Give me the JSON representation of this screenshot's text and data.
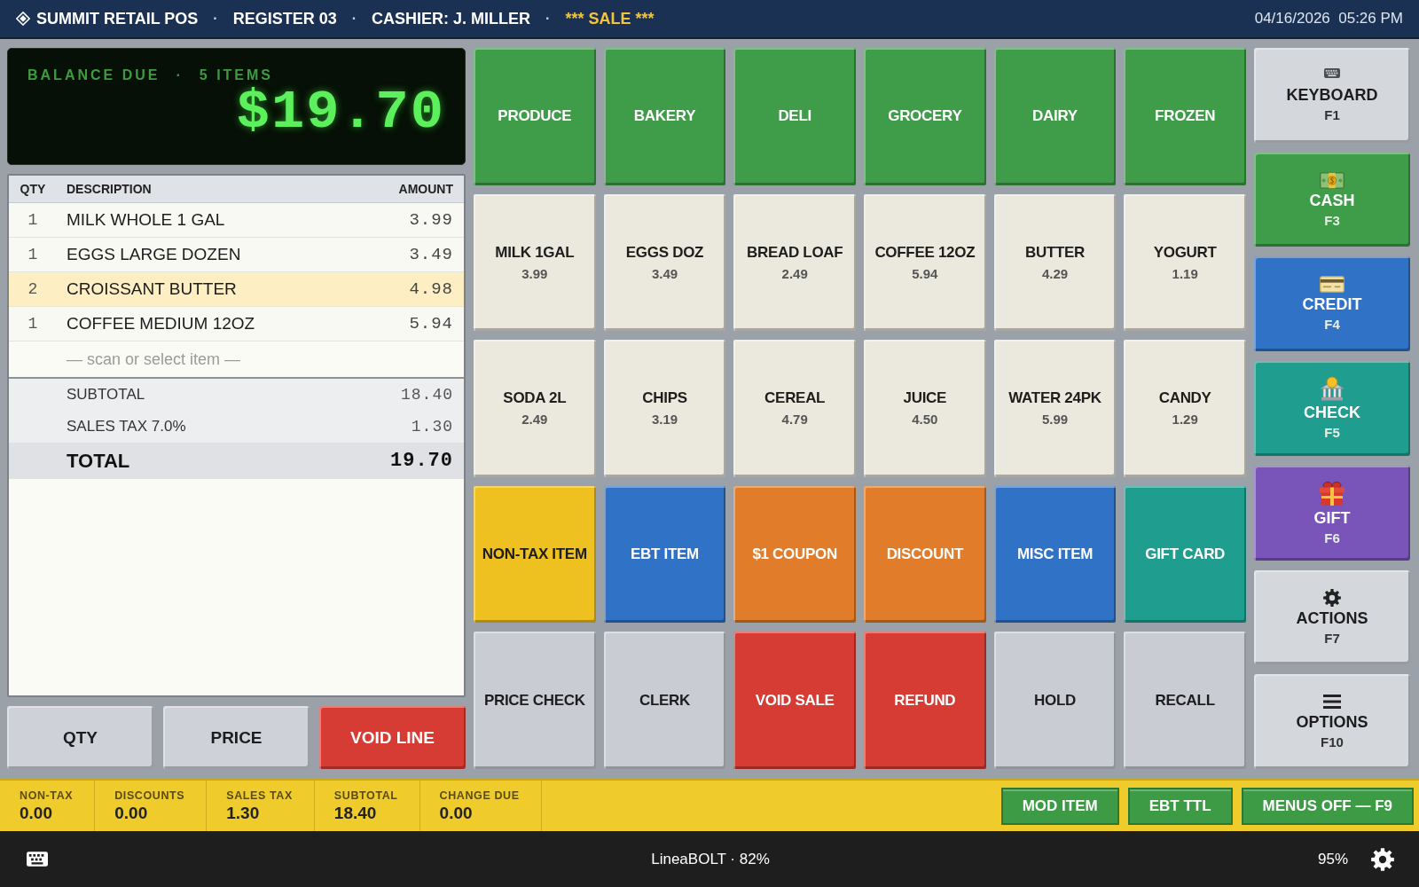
{
  "header": {
    "segments": [
      {
        "kind": "title",
        "text": "SUMMIT RETAIL POS"
      },
      {
        "kind": "sep",
        "text": "·"
      },
      {
        "kind": "info",
        "text": "REGISTER 03"
      },
      {
        "kind": "sep",
        "text": "·"
      },
      {
        "kind": "info",
        "text": "CASHIER: J. MILLER"
      },
      {
        "kind": "sep",
        "text": "·"
      },
      {
        "kind": "mode",
        "text": "*** SALE ***"
      }
    ],
    "datetime": "04/16/2026  05:26 PM"
  },
  "balance": {
    "label": "BALANCE DUE",
    "separator": "·",
    "item_count": "5 ITEMS",
    "amount": "$19.70"
  },
  "receipt": {
    "columns": [
      "QTY",
      "DESCRIPTION",
      "AMOUNT"
    ],
    "rows": [
      {
        "qty": "1",
        "description": "MILK WHOLE 1 GAL",
        "amount": "3.99",
        "selected": false
      },
      {
        "qty": "1",
        "description": "EGGS LARGE DOZEN",
        "amount": "3.49",
        "selected": false
      },
      {
        "qty": "2",
        "description": "CROISSANT BUTTER",
        "amount": "4.98",
        "selected": true
      },
      {
        "qty": "1",
        "description": "COFFEE MEDIUM 12OZ",
        "amount": "5.94",
        "selected": false
      }
    ],
    "prompt": "— scan or select item —",
    "totals": [
      {
        "kind": "line",
        "label": "SUBTOTAL",
        "value": "18.40"
      },
      {
        "kind": "line",
        "label": "SALES TAX 7.0%",
        "value": "1.30"
      },
      {
        "kind": "total",
        "label": "TOTAL",
        "value": "19.70"
      }
    ]
  },
  "line_buttons": [
    {
      "label": "QTY",
      "color": "#ced2d8"
    },
    {
      "label": "PRICE",
      "color": "#ced2d8"
    },
    {
      "label": "VOID LINE",
      "color": "#d63b34"
    }
  ],
  "keypad": [
    {
      "label": "PRODUCE",
      "color": "#3f9c48"
    },
    {
      "label": "BAKERY",
      "color": "#3f9c48"
    },
    {
      "label": "DELI",
      "color": "#3f9c48"
    },
    {
      "label": "GROCERY",
      "color": "#3f9c48"
    },
    {
      "label": "DAIRY",
      "color": "#3f9c48"
    },
    {
      "label": "FROZEN",
      "color": "#3f9c48"
    },
    {
      "label": "MILK 1GAL",
      "price": "3.99",
      "color": "#ebe8dd"
    },
    {
      "label": "EGGS DOZ",
      "price": "3.49",
      "color": "#ebe8dd"
    },
    {
      "label": "BREAD LOAF",
      "price": "2.49",
      "color": "#ebe8dd"
    },
    {
      "label": "COFFEE 12OZ",
      "price": "5.94",
      "color": "#ebe8dd"
    },
    {
      "label": "BUTTER",
      "price": "4.29",
      "color": "#ebe8dd"
    },
    {
      "label": "YOGURT",
      "price": "1.19",
      "color": "#ebe8dd"
    },
    {
      "label": "SODA 2L",
      "price": "2.49",
      "color": "#ebe8dd"
    },
    {
      "label": "CHIPS",
      "price": "3.19",
      "color": "#ebe8dd"
    },
    {
      "label": "CEREAL",
      "price": "4.79",
      "color": "#ebe8dd"
    },
    {
      "label": "JUICE",
      "price": "4.50",
      "color": "#ebe8dd"
    },
    {
      "label": "WATER 24PK",
      "price": "5.99",
      "color": "#ebe8dd"
    },
    {
      "label": "CANDY",
      "price": "1.29",
      "color": "#ebe8dd"
    },
    {
      "label": "NON-TAX ITEM",
      "color": "#efc120"
    },
    {
      "label": "EBT ITEM",
      "color": "#2f72c6"
    },
    {
      "label": "$1 COUPON",
      "color": "#e07c2a"
    },
    {
      "label": "DISCOUNT",
      "color": "#e07c2a"
    },
    {
      "label": "MISC ITEM",
      "color": "#2f72c6"
    },
    {
      "label": "GIFT CARD",
      "color": "#1f9d8f"
    },
    {
      "label": "PRICE CHECK",
      "color": "#c9cdd3"
    },
    {
      "label": "CLERK",
      "color": "#c9cdd3"
    },
    {
      "label": "VOID SALE",
      "color": "#d63b34"
    },
    {
      "label": "REFUND",
      "color": "#d63b34"
    },
    {
      "label": "HOLD",
      "color": "#c9cdd3"
    },
    {
      "label": "RECALL",
      "color": "#c9cdd3"
    }
  ],
  "side_buttons": [
    {
      "kind": "keyboard",
      "label": "KEYBOARD",
      "key": "F1",
      "color": "#d4d7dc"
    },
    {
      "kind": "cash",
      "label": "CASH",
      "key": "F3",
      "color": "#3f9c48"
    },
    {
      "kind": "credit",
      "label": "CREDIT",
      "key": "F4",
      "color": "#2f72c6"
    },
    {
      "kind": "check",
      "label": "CHECK",
      "key": "F5",
      "color": "#1f9d8f"
    },
    {
      "kind": "gift",
      "label": "GIFT",
      "key": "F6",
      "color": "#7a55b9"
    },
    {
      "kind": "actions",
      "label": "ACTIONS",
      "key": "F7",
      "color": "#d4d7dc"
    },
    {
      "kind": "options",
      "label": "OPTIONS",
      "key": "F10",
      "color": "#d4d7dc"
    }
  ],
  "summary": [
    {
      "label": "NON-TAX",
      "value": "0.00"
    },
    {
      "label": "DISCOUNTS",
      "value": "0.00"
    },
    {
      "label": "SALES TAX",
      "value": "1.30"
    },
    {
      "label": "SUBTOTAL",
      "value": "18.40"
    },
    {
      "label": "CHANGE DUE",
      "value": "0.00"
    }
  ],
  "summary_buttons": [
    "MOD ITEM",
    "EBT TTL",
    "MENUS OFF — F9"
  ],
  "status_bar": {
    "device": "LineaBOLT · 82%",
    "battery": "95%"
  }
}
